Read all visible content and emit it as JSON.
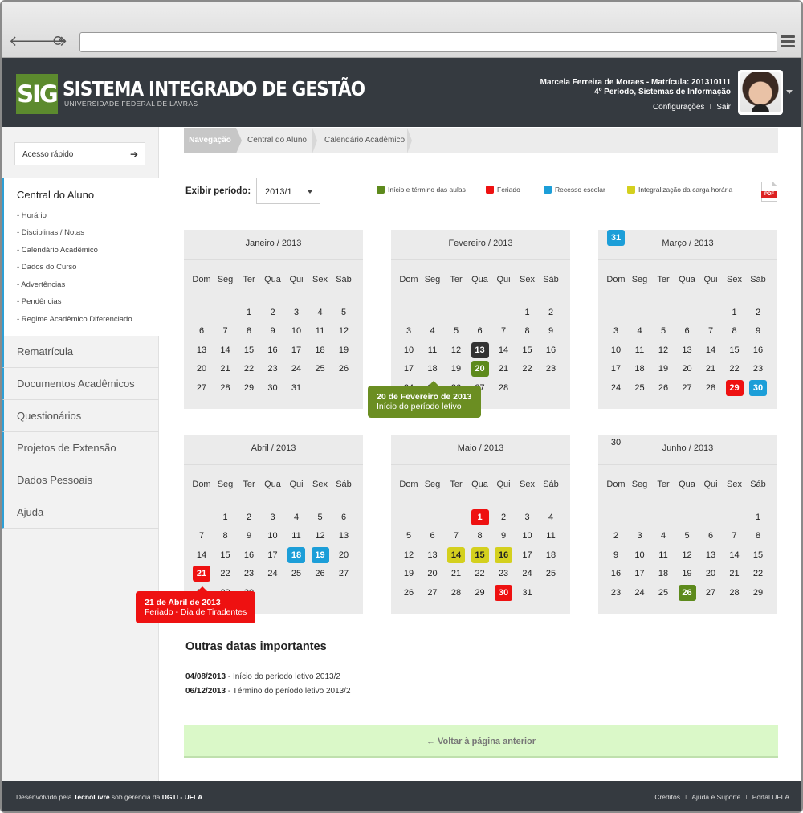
{
  "app": {
    "logo_mark": "SIG",
    "title": "SISTEMA INTEGRADO DE GESTÃO",
    "subtitle": "UNIVERSIDADE FEDERAL DE LAVRAS"
  },
  "user": {
    "name_line": "Marcela Ferreira de Moraes - Matrícula: 201310111",
    "course_line": "4º Período, Sistemas de Informação",
    "settings_link": "Configurações",
    "logout_link": "Sair",
    "link_separator": "I"
  },
  "sidebar": {
    "quick_access_label": "Acesso rápido",
    "quick_access_icon": "arrow-right-icon",
    "active_section": {
      "title": "Central do Aluno",
      "items": [
        "- Horário",
        "- Disciplinas / Notas",
        "- Calendário Acadêmico",
        "- Dados do Curso",
        "- Advertências",
        "- Pendências",
        "- Regime Acadêmico Diferenciado"
      ]
    },
    "sections": [
      "Rematrícula",
      "Documentos Acadêmicos",
      "Questionários",
      "Projetos de Extensão",
      "Dados Pessoais",
      "Ajuda"
    ],
    "accent_color": "#2d9fd6"
  },
  "breadcrumb": [
    "Navegação",
    "Central do Aluno",
    "Calendário Acadêmico"
  ],
  "period": {
    "label": "Exibir período:",
    "value": "2013/1"
  },
  "legend": [
    {
      "label": "Início e término das aulas",
      "color": "#5d8a1c"
    },
    {
      "label": "Feriado",
      "color": "#ee1111"
    },
    {
      "label": "Recesso escolar",
      "color": "#1c9ed8"
    },
    {
      "label": "Integralização da carga horária",
      "color": "#d4d01e"
    }
  ],
  "pdf_icon": {
    "name": "pdf-icon",
    "label": "PDF"
  },
  "weekdays": [
    "Dom",
    "Seg",
    "Ter",
    "Qua",
    "Qui",
    "Sex",
    "Sáb"
  ],
  "months": [
    {
      "title": "Janeiro / 2013",
      "first_weekday": 2,
      "days": 31,
      "marks": {}
    },
    {
      "title": "Fevereiro / 2013",
      "first_weekday": 5,
      "days": 28,
      "marks": {
        "13": "today",
        "20": "aulas"
      }
    },
    {
      "title": "Março / 2013",
      "first_weekday": 5,
      "days": 31,
      "marks": {
        "29": "feriado",
        "30": "recesso",
        "31": "recesso"
      }
    },
    {
      "title": "Abril / 2013",
      "first_weekday": 1,
      "days": 30,
      "marks": {
        "18": "recesso",
        "19": "recesso",
        "21": "feriado"
      }
    },
    {
      "title": "Maio / 2013",
      "first_weekday": 3,
      "days": 31,
      "marks": {
        "1": "feriado",
        "14": "integralizacao",
        "15": "integralizacao",
        "16": "integralizacao",
        "30": "feriado"
      }
    },
    {
      "title": "Junho / 2013",
      "first_weekday": 6,
      "days": 30,
      "marks": {
        "26": "aulas"
      }
    }
  ],
  "mark_colors": {
    "today": "#333333",
    "aulas": "#5d8a1c",
    "feriado": "#ee1111",
    "recesso": "#1c9ed8",
    "integralizacao": "#d4d01e"
  },
  "tooltips": [
    {
      "title": "20 de Fevereiro de 2013",
      "text": "Início do período letivo",
      "color": "#6b8e22"
    },
    {
      "title": "21 de Abril de 2013",
      "text": "Feriado - Dia de Tiradentes",
      "color": "#ee1111"
    }
  ],
  "other_dates": {
    "heading": "Outras datas importantes",
    "items": [
      {
        "date": "04/08/2013",
        "text": " - Início do período letivo 2013/2"
      },
      {
        "date": "06/12/2013",
        "text": " - Término do período letivo 2013/2"
      }
    ]
  },
  "back_button": "← Voltar à página anterior",
  "footer": {
    "prefix": "Desenvolvido pela ",
    "company": "TecnoLivre",
    "middle": " sob gerência da ",
    "dept": "DGTI - UFLA",
    "links": [
      "Créditos",
      "Ajuda e Suporte",
      "Portal UFLA"
    ],
    "separator": "I"
  }
}
